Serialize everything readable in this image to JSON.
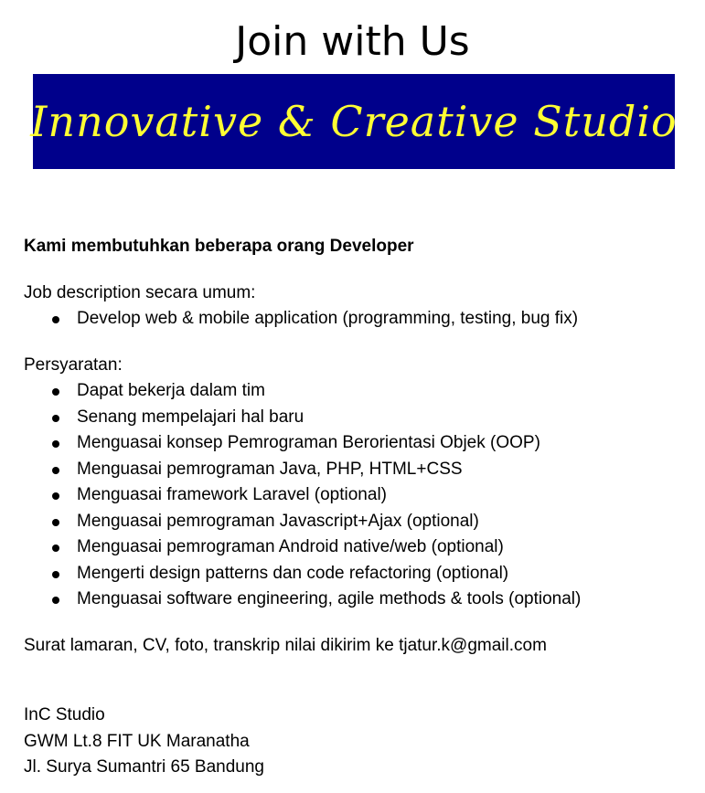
{
  "header": {
    "title": "Join with Us",
    "banner_text": "Innovative & Creative Studio"
  },
  "intro": "Kami membutuhkan beberapa orang Developer",
  "job": {
    "heading": "Job description secara umum:",
    "items": [
      "Develop web & mobile application (programming, testing, bug fix)"
    ]
  },
  "requirements": {
    "heading": "Persyaratan:",
    "items": [
      "Dapat bekerja dalam tim",
      "Senang mempelajari hal baru",
      "Menguasai konsep Pemrograman Berorientasi Objek (OOP)",
      "Menguasai pemrograman Java, PHP, HTML+CSS",
      "Menguasai framework Laravel (optional)",
      "Menguasai pemrograman Javascript+Ajax (optional)",
      "Menguasai pemrograman Android native/web (optional)",
      "Mengerti design patterns dan code refactoring (optional)",
      "Menguasai software engineering, agile methods & tools (optional)"
    ]
  },
  "application": "Surat lamaran, CV, foto, transkrip nilai dikirim ke tjatur.k@gmail.com",
  "contact": {
    "company": "InC Studio",
    "address1": "GWM Lt.8 FIT UK Maranatha",
    "address2": "Jl. Surya Sumantri 65 Bandung"
  }
}
